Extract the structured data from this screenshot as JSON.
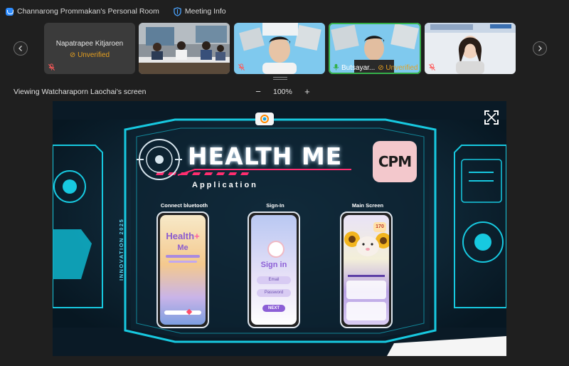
{
  "topbar": {
    "room_title": "Channarong Prommakan's Personal Room",
    "meeting_info": "Meeting Info"
  },
  "gallery": {
    "tiles": [
      {
        "name": "Napatrapee Kitjaroen",
        "status": "Unverified",
        "muted": true
      },
      {
        "name": "",
        "status": "",
        "muted": false
      },
      {
        "name": "",
        "status": "",
        "muted": true
      },
      {
        "name": "Butsayar...",
        "status": "Unverified",
        "muted": true,
        "active": true
      },
      {
        "name": "",
        "status": "",
        "muted": true
      }
    ]
  },
  "viewbar": {
    "title": "Viewing Watcharaporn Laochai's screen",
    "zoom_out": "−",
    "zoom_level": "100%",
    "zoom_in": "+"
  },
  "slide": {
    "title": "HEALTH ME",
    "subtitle": "Application",
    "side_text": "INNOVATION 2025",
    "logo_text": "CPM",
    "phones": [
      {
        "label": "Connect bluetooth",
        "app_name_1": "Health",
        "app_name_2": "Me"
      },
      {
        "label": "Sign-In",
        "heading": "Sign in",
        "field1": "Email",
        "field2": "Password",
        "button": "NEXT"
      },
      {
        "label": "Main Screen",
        "badge": "170"
      }
    ]
  },
  "colors": {
    "accent_cyan": "#17c9e0",
    "accent_pink": "#ff2d6f",
    "unverified": "#e6a020",
    "active_border": "#35b04a"
  }
}
